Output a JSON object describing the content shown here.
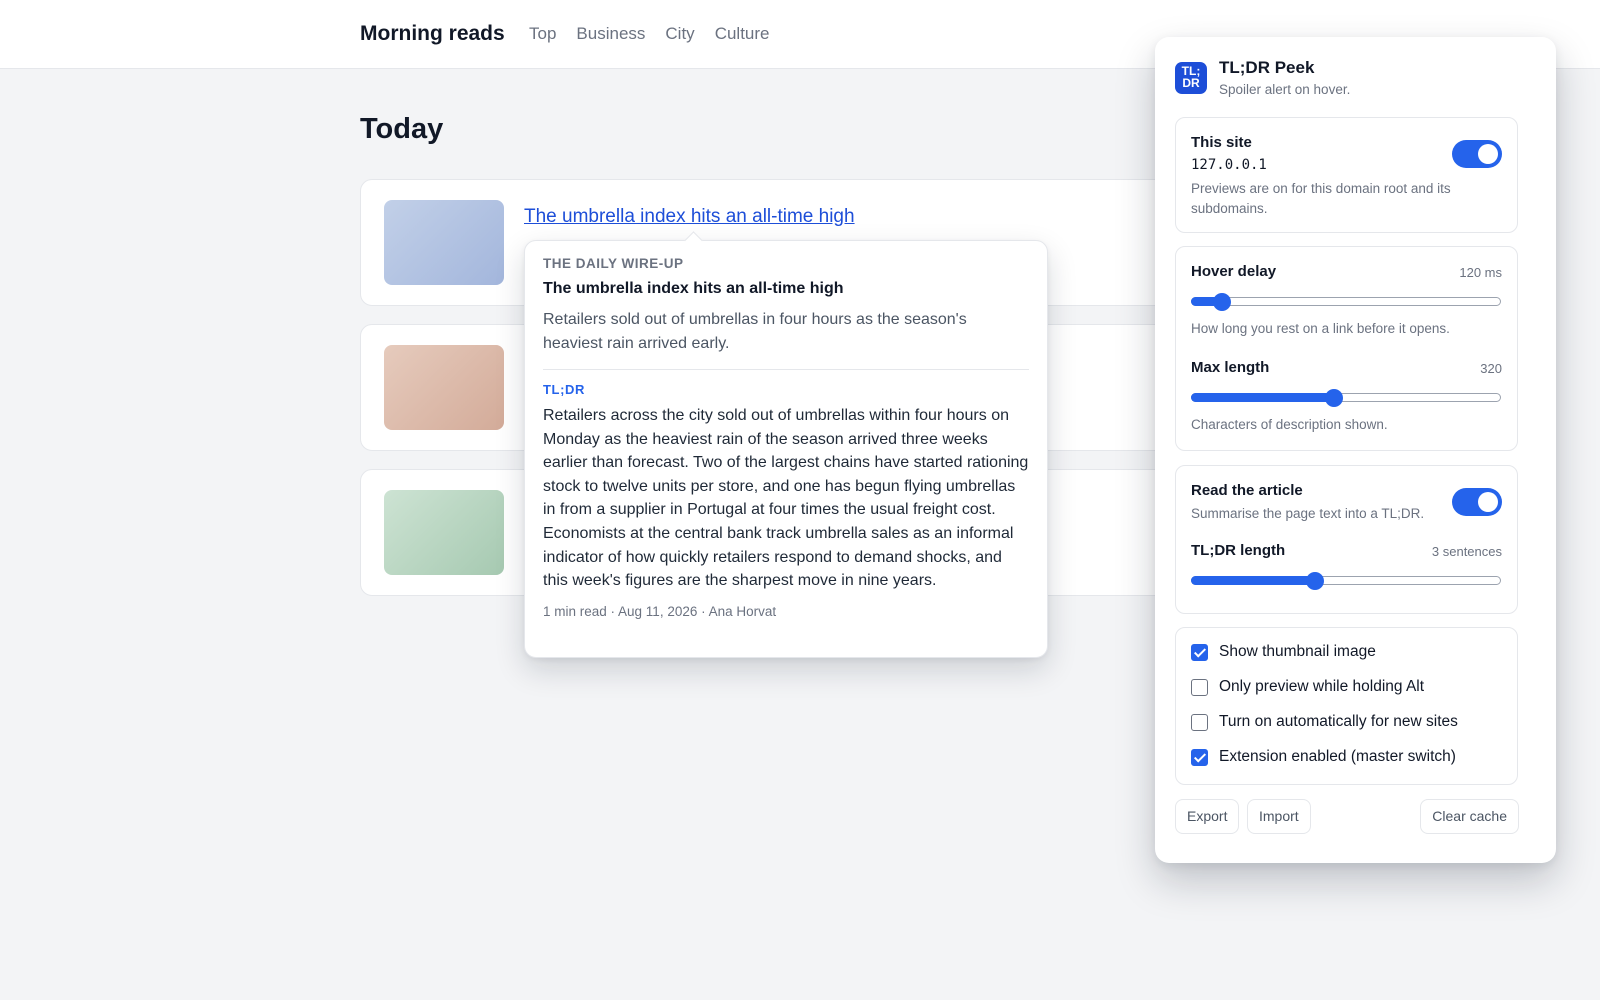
{
  "site": {
    "brand": "Morning reads",
    "nav": [
      "Top",
      "Business",
      "City",
      "Culture"
    ],
    "page_title": "Today"
  },
  "articles": [
    {
      "title": "The umbrella index hits an all-time high",
      "thumb_colors": [
        "#c2d0e8",
        "#a3b6dc"
      ]
    },
    {
      "title": "",
      "thumb_colors": [
        "#e6cbbd",
        "#d3ab99"
      ]
    },
    {
      "title": "",
      "thumb_colors": [
        "#cde3d3",
        "#a6c9b1"
      ]
    }
  ],
  "popover": {
    "source": "THE DAILY WIRE-UP",
    "title": "The umbrella index hits an all-time high",
    "description": "Retailers sold out of umbrellas in four hours as the season's heaviest rain arrived early.",
    "tldr_label": "TL;DR",
    "tldr": "Retailers across the city sold out of umbrellas within four hours on Monday as the heaviest rain of the season arrived three weeks earlier than forecast. Two of the largest chains have started rationing stock to twelve units per store, and one has begun flying umbrellas in from a supplier in Portugal at four times the usual freight cost. Economists at the central bank track umbrella sales as an informal indicator of how quickly retailers respond to demand shocks, and this week's figures are the sharpest move in nine years.",
    "meta": "1 min read · Aug 11, 2026 · Ana Horvat"
  },
  "panel": {
    "logo_text": [
      "TL;",
      "DR"
    ],
    "title": "TL;DR Peek",
    "tagline": "Spoiler alert on hover.",
    "this_site": {
      "label": "This site",
      "domain": "127.0.0.1",
      "help": "Previews are on for this domain root and its subdomains.",
      "enabled": true
    },
    "hover_delay": {
      "label": "Hover delay",
      "value_text": "120 ms",
      "level": 0.1,
      "help": "How long you rest on a link before it opens."
    },
    "max_length": {
      "label": "Max length",
      "value_text": "320",
      "level": 0.46,
      "help": "Characters of description shown."
    },
    "read_article": {
      "label": "Read the article",
      "help": "Summarise the page text into a TL;DR.",
      "enabled": true
    },
    "tldr_length": {
      "label": "TL;DR length",
      "value_text": "3 sentences",
      "level": 0.4
    },
    "options": [
      {
        "label": "Show thumbnail image",
        "checked": true
      },
      {
        "label": "Only preview while holding Alt",
        "checked": false
      },
      {
        "label": "Turn on automatically for new sites",
        "checked": false
      },
      {
        "label": "Extension enabled (master switch)",
        "checked": true
      }
    ],
    "buttons": {
      "export": "Export",
      "import": "Import",
      "clear_cache": "Clear cache"
    }
  },
  "colors": {
    "accent": "#2563eb",
    "link": "#1d4ed8",
    "background": "#f3f4f6"
  }
}
